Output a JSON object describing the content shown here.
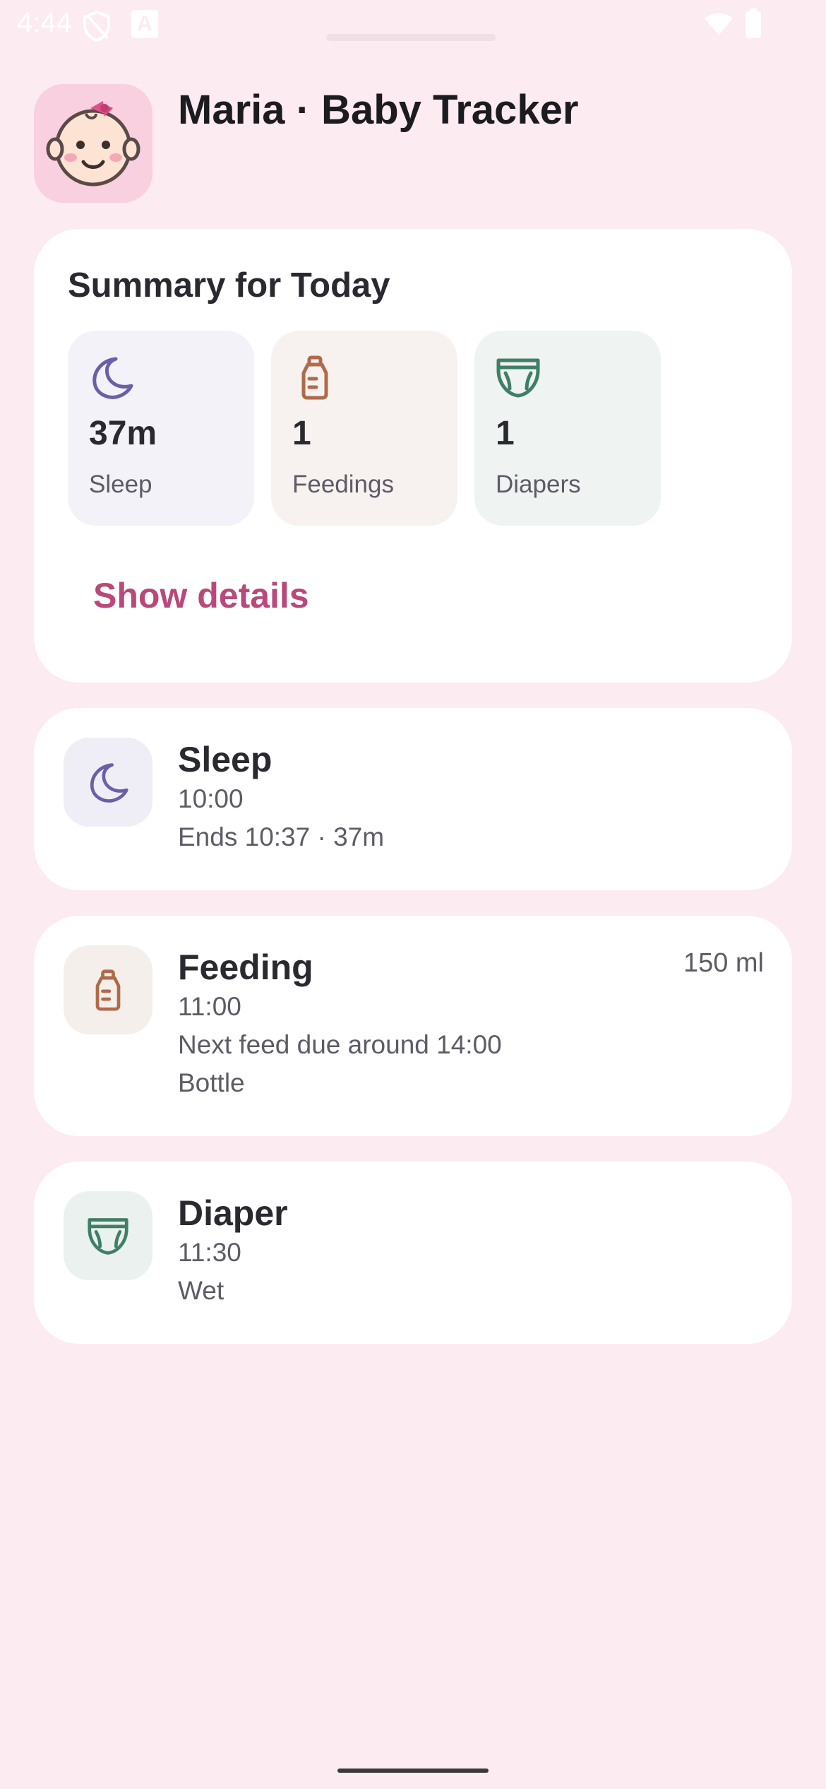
{
  "status_bar": {
    "time": "4:44",
    "a_label": "A"
  },
  "header": {
    "title": "Maria · Baby Tracker",
    "avatar_icon": "baby-face-icon"
  },
  "summary": {
    "title": "Summary for Today",
    "tiles": [
      {
        "icon": "moon-icon",
        "value": "37m",
        "label": "Sleep",
        "color": "#6a5fa8"
      },
      {
        "icon": "bottle-icon",
        "value": "1",
        "label": "Feedings",
        "color": "#b06a4a"
      },
      {
        "icon": "diaper-icon",
        "value": "1",
        "label": "Diapers",
        "color": "#3f7f66"
      }
    ],
    "show_details": "Show details"
  },
  "events": [
    {
      "type": "Sleep",
      "icon": "moon-icon",
      "time": "10:00",
      "lines": [
        "Ends 10:37 · 37m"
      ]
    },
    {
      "type": "Feeding",
      "icon": "bottle-icon",
      "time": "11:00",
      "amount": "150 ml",
      "lines": [
        "Next feed due around 14:00",
        "Bottle"
      ]
    },
    {
      "type": "Diaper",
      "icon": "diaper-icon",
      "time": "11:30",
      "lines": [
        "Wet"
      ]
    }
  ],
  "colors": {
    "background": "#fcebf1",
    "accent": "#b9497a",
    "sleep": "#6a5fa8",
    "feeding": "#b06a4a",
    "diaper": "#3f7f66"
  }
}
